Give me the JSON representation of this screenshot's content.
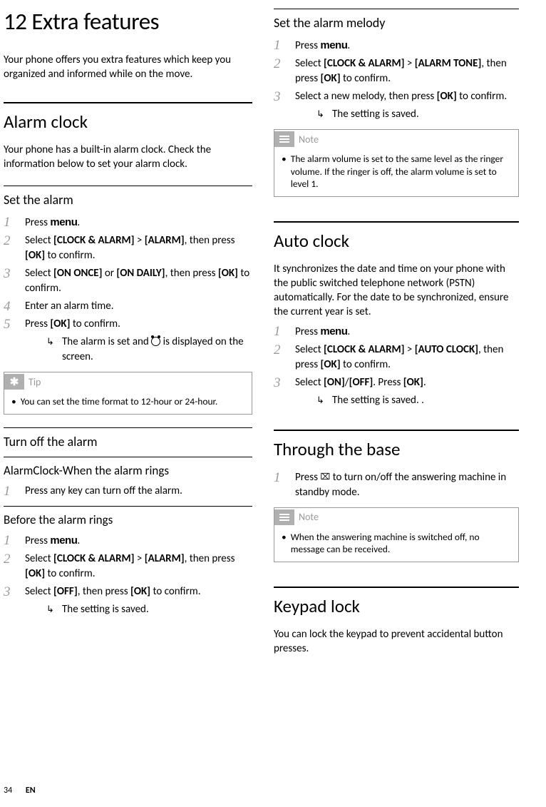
{
  "page": {
    "number": "34",
    "lang": "EN"
  },
  "left": {
    "chapter_title": "12 Extra features",
    "intro": "Your phone offers you extra features which keep you organized and informed while on the move.",
    "alarm_clock": {
      "heading": "Alarm clock",
      "desc": "Your phone has a built-in alarm clock. Check the information below to set your alarm clock.",
      "set_alarm": {
        "heading": "Set the alarm",
        "steps": {
          "s1_a": "Press ",
          "s1_menu": "menu",
          "s1_b": ".",
          "s2_a": "Select ",
          "s2_b": "[CLOCK & ALARM]",
          "s2_c": " > ",
          "s2_d": "[ALARM]",
          "s2_e": ", then press ",
          "s2_f": "[OK]",
          "s2_g": " to confirm.",
          "s3_a": "Select ",
          "s3_b": "[ON ONCE]",
          "s3_c": " or ",
          "s3_d": "[ON DAILY]",
          "s3_e": ", then press ",
          "s3_f": "[OK]",
          "s3_g": " to confirm.",
          "s4": "Enter an alarm time.",
          "s5_a": "Press ",
          "s5_b": "[OK]",
          "s5_c": " to confirm.",
          "result_a": "The alarm is set and ",
          "result_b": " is displayed on the screen."
        },
        "tip_label": "Tip",
        "tip_body": "You can set the time format to 12-hour or 24-hour."
      },
      "turn_off": {
        "heading": "Turn off the alarm",
        "when_rings_heading": "AlarmClock-When the alarm rings",
        "when_rings_step": "Press any key can turn off the alarm.",
        "before_heading": "Before the alarm rings",
        "steps": {
          "s1_a": "Press ",
          "s1_menu": "menu",
          "s1_b": ".",
          "s2_a": "Select ",
          "s2_b": "[CLOCK & ALARM]",
          "s2_c": " > ",
          "s2_d": "[ALARM]",
          "s2_e": ", then press ",
          "s2_f": "[OK]",
          "s2_g": " to confirm.",
          "s3_a": "Select ",
          "s3_b": "[OFF]",
          "s3_c": ", then press ",
          "s3_d": "[OK]",
          "s3_e": " to confirm.",
          "result": "The setting is saved."
        }
      }
    }
  },
  "right": {
    "melody": {
      "heading": "Set the alarm melody",
      "steps": {
        "s1_a": "Press ",
        "s1_menu": "menu",
        "s1_b": ".",
        "s2_a": "Select ",
        "s2_b": "[CLOCK & ALARM]",
        "s2_c": " > ",
        "s2_d": "[ALARM TONE]",
        "s2_e": ", then press ",
        "s2_f": "[OK]",
        "s2_g": " to confirm.",
        "s3_a": "Select a new melody, then press ",
        "s3_b": "[OK]",
        "s3_c": " to confirm.",
        "result": "The setting is saved."
      },
      "note_label": "Note",
      "note_body": "The alarm volume is set to the same level as the ringer volume. If the ringer is off, the alarm volume is set to level 1."
    },
    "auto_clock": {
      "heading": "Auto clock",
      "desc": "It synchronizes the date and time on your phone with the public switched telephone network (PSTN) automatically. For the date to be synchronized, ensure the current year is set.",
      "steps": {
        "s1_a": "Press ",
        "s1_menu": "menu",
        "s1_b": ".",
        "s2_a": "Select ",
        "s2_b": "[CLOCK & ALARM]",
        "s2_c": " > ",
        "s2_d": "[AUTO CLOCK]",
        "s2_e": ", then press ",
        "s2_f": "[OK]",
        "s2_g": " to confirm.",
        "s3_a": "Select ",
        "s3_b": "[ON]",
        "s3_c": "/",
        "s3_d": "[OFF]",
        "s3_e": ". Press ",
        "s3_f": "[OK]",
        "s3_g": ".",
        "result": "The setting is saved. ."
      }
    },
    "base": {
      "heading": "Through the base",
      "step_a": "Press ",
      "step_b": " to turn on/off the answering machine in standby mode.",
      "note_label": "Note",
      "note_body": "When the answering machine is switched off, no message can be received."
    },
    "keypad": {
      "heading": "Keypad lock",
      "desc": "You can lock the keypad to prevent accidental button presses."
    }
  }
}
